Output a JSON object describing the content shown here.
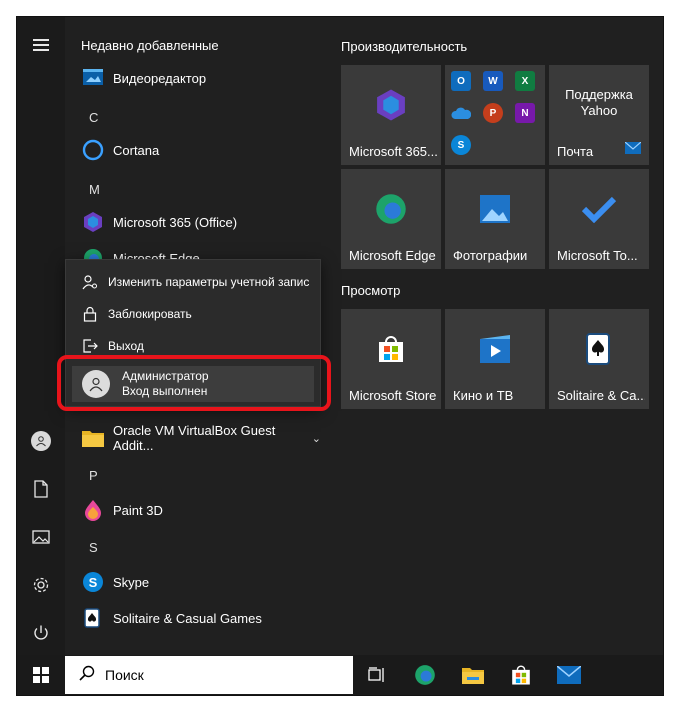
{
  "list": {
    "recent_header": "Недавно добавленные",
    "items": [
      {
        "label": "Видеоредактор"
      },
      {
        "letter": "C"
      },
      {
        "label": "Cortana"
      },
      {
        "letter": "M"
      },
      {
        "label": "Microsoft 365 (Office)"
      },
      {
        "label": "Microsoft Edge"
      },
      {
        "label": "Oracle VM VirtualBox Guest Addit..."
      },
      {
        "letter": "P"
      },
      {
        "label": "Paint 3D"
      },
      {
        "letter": "S"
      },
      {
        "label": "Skype"
      },
      {
        "label": "Solitaire & Casual Games"
      }
    ]
  },
  "account_menu": {
    "change_settings": "Изменить параметры учетной запис",
    "lock": "Заблокировать",
    "signout": "Выход",
    "user_name": "Администратор",
    "user_status": "Вход выполнен"
  },
  "tiles": {
    "group1_title": "Производительность",
    "group2_title": "Просмотр",
    "t_m365": "Microsoft 365...",
    "t_support_line1": "Поддержка",
    "t_support_line2": "Yahoo",
    "t_mail": "Почта",
    "t_edge": "Microsoft Edge",
    "t_photos": "Фотографии",
    "t_todo": "Microsoft To...",
    "t_store": "Microsoft Store",
    "t_movies": "Кино и ТВ",
    "t_solitaire": "Solitaire & Ca..."
  },
  "taskbar": {
    "search_placeholder": "Поиск"
  },
  "colors": {
    "highlight": "#e8141b",
    "accent": "#0078d4"
  }
}
